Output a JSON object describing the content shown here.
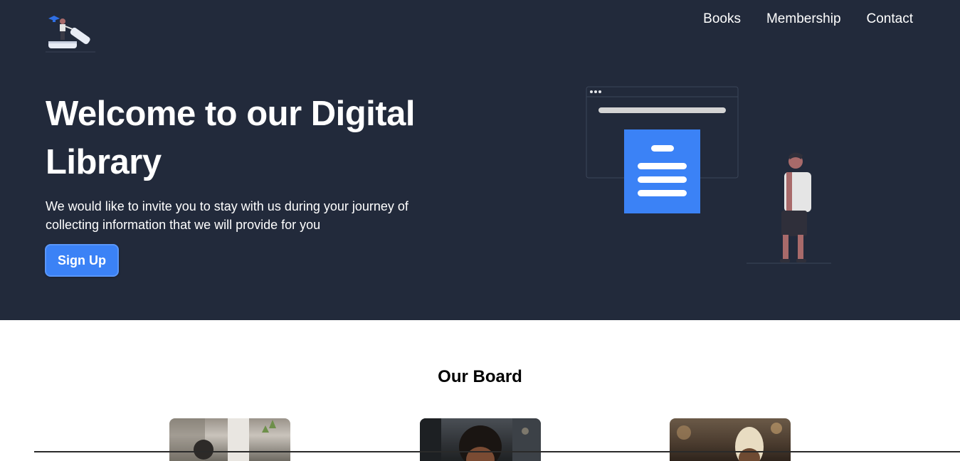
{
  "nav": {
    "items": [
      {
        "label": "Books"
      },
      {
        "label": "Membership"
      },
      {
        "label": "Contact"
      }
    ]
  },
  "hero": {
    "title": "Welcome to our Digital Library",
    "text": "We would like to invite you to stay with us during your journey of collecting information that we will provide for you",
    "signup_label": "Sign Up"
  },
  "board": {
    "title": "Our Board",
    "members": [
      {
        "photo": "board-member-1-photo"
      },
      {
        "photo": "board-member-2-photo"
      },
      {
        "photo": "board-member-3-photo"
      }
    ]
  },
  "colors": {
    "hero_background": "#222a3b",
    "accent": "#3b82f6",
    "page_background": "#ffffff"
  }
}
